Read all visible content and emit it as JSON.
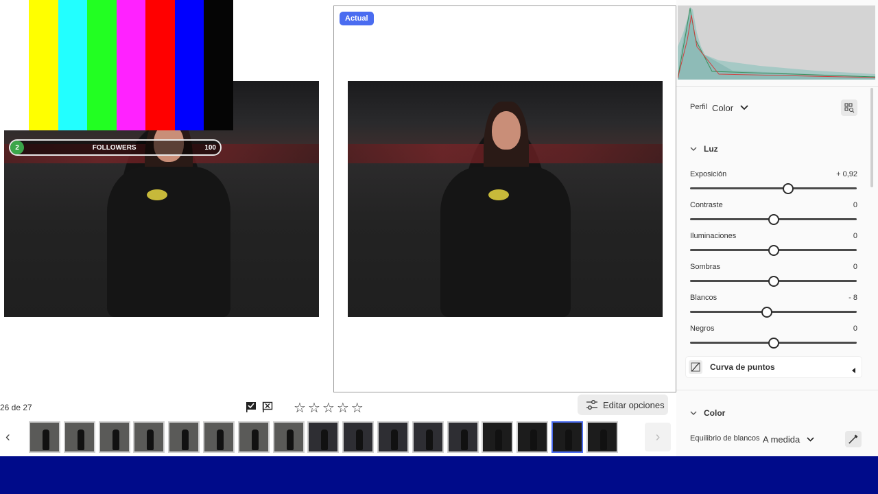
{
  "compare": {
    "badge": "Actual",
    "followers": {
      "count_left": "2",
      "label": "FOLLOWERS",
      "count_right": "100"
    },
    "color_bars": [
      "#ffff00",
      "#22ffff",
      "#22ff22",
      "#ff22ff",
      "#ff0000",
      "#0000ff",
      "#050505"
    ]
  },
  "status": {
    "counter": "26 de 27"
  },
  "toolbar": {
    "edit_options_label": "Editar opciones",
    "stars": 5
  },
  "panel": {
    "profile_label": "Perfil",
    "profile_value": "Color",
    "light_section": "Luz",
    "sliders": [
      {
        "label": "Exposición",
        "value": "+ 0,92",
        "position": 0.59
      },
      {
        "label": "Contraste",
        "value": "0",
        "position": 0.5
      },
      {
        "label": "Iluminaciones",
        "value": "0",
        "position": 0.5
      },
      {
        "label": "Sombras",
        "value": "0",
        "position": 0.5
      },
      {
        "label": "Blancos",
        "value": "- 8",
        "position": 0.46
      },
      {
        "label": "Negros",
        "value": "0",
        "position": 0.5
      }
    ],
    "curve_label": "Curva de puntos",
    "color_section": "Color",
    "wb_label": "Equilibrio de blancos",
    "wb_value": "A medida"
  },
  "filmstrip": {
    "count": 17,
    "selected_index": 15
  }
}
